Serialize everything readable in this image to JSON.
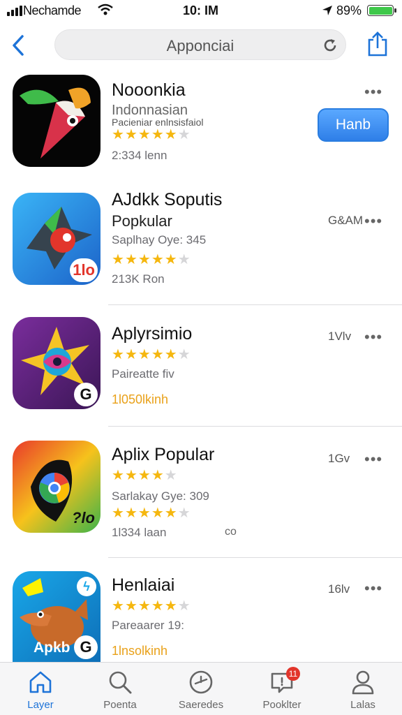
{
  "status_bar": {
    "carrier": "Nechamde",
    "time": "10: IM",
    "battery_pct": "89%"
  },
  "nav": {
    "search_text": "Apponciai"
  },
  "apps": [
    {
      "name": "Nooonkia",
      "subtitle": "Indonnasian",
      "detail": "Pacieniar enlnsisfaiol",
      "rating": 4.5,
      "downloads": "2:334 lenn",
      "button_label": "Hanb",
      "icon_colors": [
        "#050505",
        "#e23a4c",
        "#f0a328"
      ]
    },
    {
      "name": "AJdkk Soputis",
      "category": "Popkular",
      "detail": "Saplhay Oye: 345",
      "rating": 4.5,
      "downloads": "213K Ron",
      "size": "G&AM",
      "badge": "1lo",
      "icon_colors": [
        "#2da0f0",
        "#1c63c9",
        "#e2352b"
      ]
    },
    {
      "name": "Aplyrsimio",
      "detail": "Paireatte fiv",
      "rating": 4.5,
      "downloads": "1l050lkinh",
      "size": "1Vlv",
      "badge": "G",
      "icon_colors": [
        "#5b1f7d",
        "#d83a8c",
        "#f5c425"
      ]
    },
    {
      "name": "Aplix Popular",
      "detail": "Sarlakay Gye: 309",
      "rating": 4,
      "rating2": 4.5,
      "downloads": "1l334 laan",
      "size": "1Gv",
      "extra": "co",
      "badge": "?lo",
      "icon_colors": [
        "#e9392b",
        "#f6c21c",
        "#3db34a"
      ]
    },
    {
      "name": "Henlaiai",
      "detail": "Pareaarer 19:",
      "rating": 4.5,
      "downloads": "1lnsolkinh",
      "size": "16lv",
      "badge": "G",
      "badge_text": "Apkb",
      "icon_colors": [
        "#19a7e8",
        "#c86a2a",
        "#fff200"
      ]
    }
  ],
  "tabs": [
    {
      "label": "Layer",
      "active": true
    },
    {
      "label": "Poenta",
      "active": false
    },
    {
      "label": "Saeredes",
      "active": false
    },
    {
      "label": "Pooklter",
      "active": false,
      "badge": "11"
    },
    {
      "label": "Lalas",
      "active": false
    }
  ],
  "colors": {
    "accent": "#1d73d8",
    "star": "#f5b70f",
    "badge": "#e2352b"
  }
}
